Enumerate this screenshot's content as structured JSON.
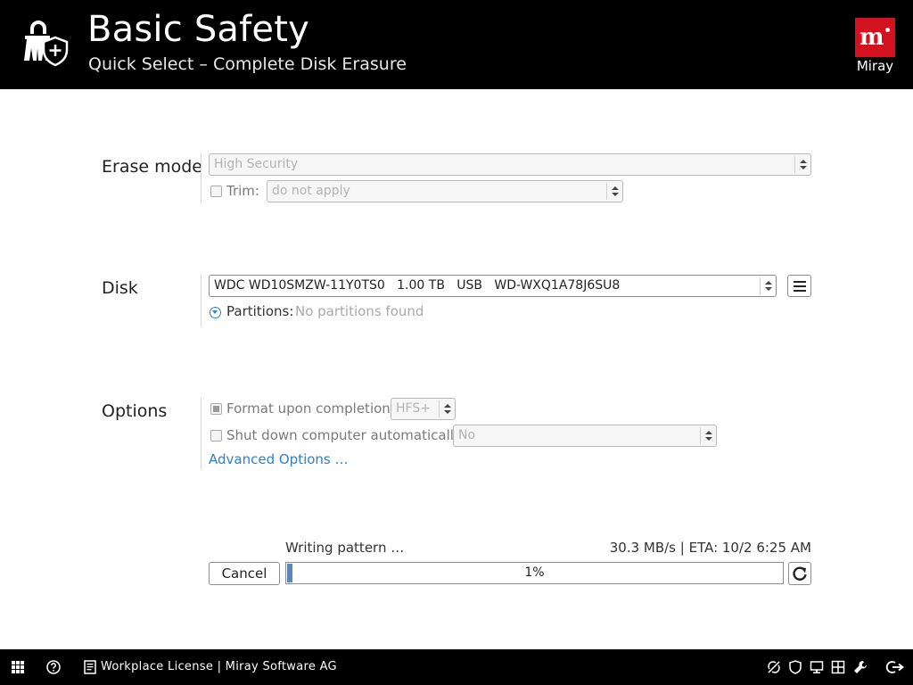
{
  "header": {
    "title": "Basic Safety",
    "subtitle": "Quick Select – Complete Disk Erasure",
    "brand": "Miray"
  },
  "erase_mode": {
    "label": "Erase mode",
    "mode_value": "High Security",
    "trim_label": "Trim:",
    "trim_value": "do not apply"
  },
  "disk": {
    "label": "Disk",
    "disk_value": "WDC WD10SMZW-11Y0TS0   1.00 TB   USB   WD-WXQ1A78J6SU8",
    "partitions_label": "Partitions:",
    "partitions_value": "No partitions found"
  },
  "options": {
    "label": "Options",
    "format_label": "Format upon completion:",
    "format_value": "HFS+",
    "shutdown_label": "Shut down computer automatically:",
    "shutdown_value": "No",
    "advanced_link": "Advanced Options …"
  },
  "progress": {
    "status": "Writing pattern …",
    "rate": "30.3 MB/s | ETA: 10/2 6:25 AM",
    "percent_label": "1%",
    "percent": 1,
    "cancel_label": "Cancel"
  },
  "taskbar": {
    "license": "Workplace License | Miray Software AG"
  },
  "colors": {
    "header_bg": "#000000",
    "brand_red": "#d4121f",
    "link_blue": "#2f7fc1",
    "progress_fill": "#5b84b8"
  }
}
